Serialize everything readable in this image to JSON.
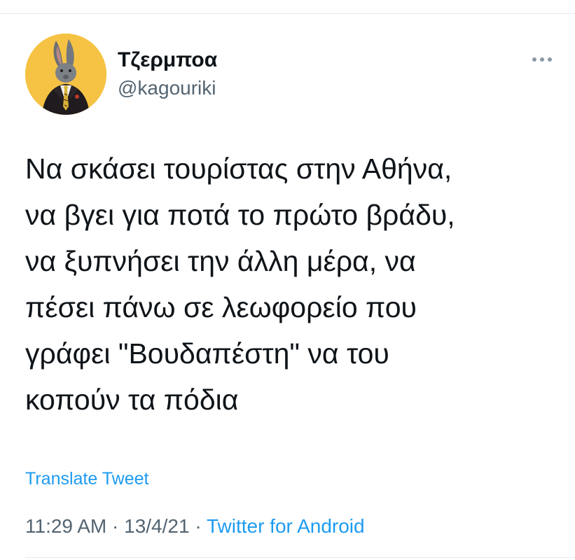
{
  "tweet": {
    "author": {
      "display_name": "Τζερμποα",
      "handle": "@kagouriki",
      "avatar_icon": "rabbit-in-suit-avatar",
      "avatar_bg_color": "#f5c243"
    },
    "more_icon": "more-horizontal-icon",
    "text": "Να σκάσει τουρίστας στην Αθήνα,\nνα βγει για ποτά το πρώτο βράδυ,\nνα ξυπνήσει την άλλη μέρα, να\nπέσει πάνω σε λεωφορείο που\nγράφει \"Βουδαπέστη\" να του\nκοπούν τα πόδια",
    "translate_label": "Translate Tweet",
    "time": "11:29 AM",
    "date": "13/4/21",
    "separator": "·",
    "source": "Twitter for Android",
    "link_color": "#1d9bf0"
  }
}
